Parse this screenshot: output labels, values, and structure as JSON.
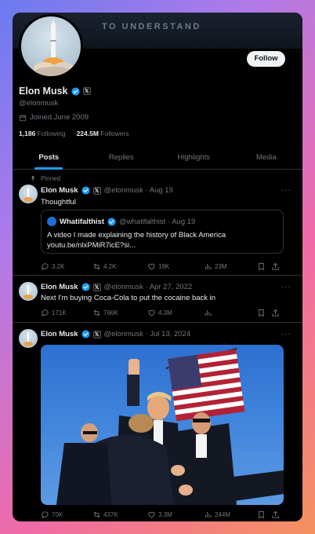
{
  "banner": {
    "text": "TO UNDERSTAND"
  },
  "profile": {
    "name": "Elon Musk",
    "handle": "@elonmusk",
    "joined": "Joined June 2009",
    "following_count": "1,186",
    "following_label": "Following",
    "followers_count": "224.5M",
    "followers_label": "Followers",
    "follow_label": "Follow"
  },
  "tabs": [
    "Posts",
    "Replies",
    "Highlights",
    "Media"
  ],
  "tweets": [
    {
      "pinned_label": "Pinned",
      "name": "Elon Musk",
      "meta": "@elonmusk · Aug 19",
      "text": "Thoughtful",
      "quote": {
        "name": "Whatifalthist",
        "meta": "@whatifalthist · Aug 19",
        "line1": "A video I made explaining the history of Black America",
        "line2": "youtu.be/nlxPMiR7icE?si..."
      },
      "actions": {
        "replies": "3.2K",
        "reposts": "4.2K",
        "likes": "19K",
        "views": "23M"
      }
    },
    {
      "name": "Elon Musk",
      "meta": "@elonmusk · Apr 27, 2022",
      "text": "Next I'm buying Coca-Cola to put the cocaine back in",
      "actions": {
        "replies": "171K",
        "reposts": "766K",
        "likes": "4.3M",
        "views": ""
      }
    },
    {
      "name": "Elon Musk",
      "meta": "@elonmusk · Jul 13, 2024",
      "actions": {
        "replies": "70K",
        "reposts": "437K",
        "likes": "3.3M",
        "views": "244M"
      }
    }
  ],
  "colors": {
    "accent": "#1d9bf0",
    "background": "#000000",
    "muted": "#71767b"
  }
}
